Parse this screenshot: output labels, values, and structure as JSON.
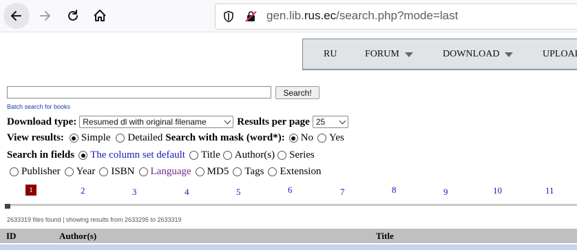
{
  "browser": {
    "url_prefix": "gen.lib.",
    "url_domain": "rus.ec",
    "url_path": "/search.php?mode=last"
  },
  "menu": {
    "items": [
      {
        "label": "RU"
      },
      {
        "label": "FORUM"
      },
      {
        "label": "DOWNLOAD"
      },
      {
        "label": "UPLOAD"
      }
    ]
  },
  "search": {
    "value": "",
    "button_label": "Search!",
    "batch_link": "Batch search for books"
  },
  "download": {
    "label": "Download type:",
    "selected": "Resumed dl with original filename",
    "per_page_label": "Results per page",
    "per_page_selected": "25"
  },
  "view": {
    "label": "View results:",
    "simple": "Simple",
    "detailed": "Detailed",
    "mask_label": "Search with mask (word*):",
    "no": "No",
    "yes": "Yes"
  },
  "fields": {
    "label": "Search in fields",
    "options_row1": [
      "The column set default",
      "Title",
      "Author(s)",
      "Series"
    ],
    "options_row2": [
      "Publisher",
      "Year",
      "ISBN",
      "Language",
      "MD5",
      "Tags",
      "Extension"
    ]
  },
  "pagination": {
    "pages": [
      "1",
      "2",
      "3",
      "4",
      "5",
      "6",
      "7",
      "8",
      "9",
      "10",
      "11"
    ],
    "current": "1"
  },
  "results": {
    "summary": "2633319 files found | showing results from 2633295 to 2633319",
    "columns": [
      "ID",
      "Author(s)",
      "Title"
    ]
  },
  "colors": {
    "current_page_bg": "#8b0000",
    "link": "#1a1ab8",
    "header_bg": "#c0c0c0",
    "row_bg": "#c6d4ec"
  }
}
